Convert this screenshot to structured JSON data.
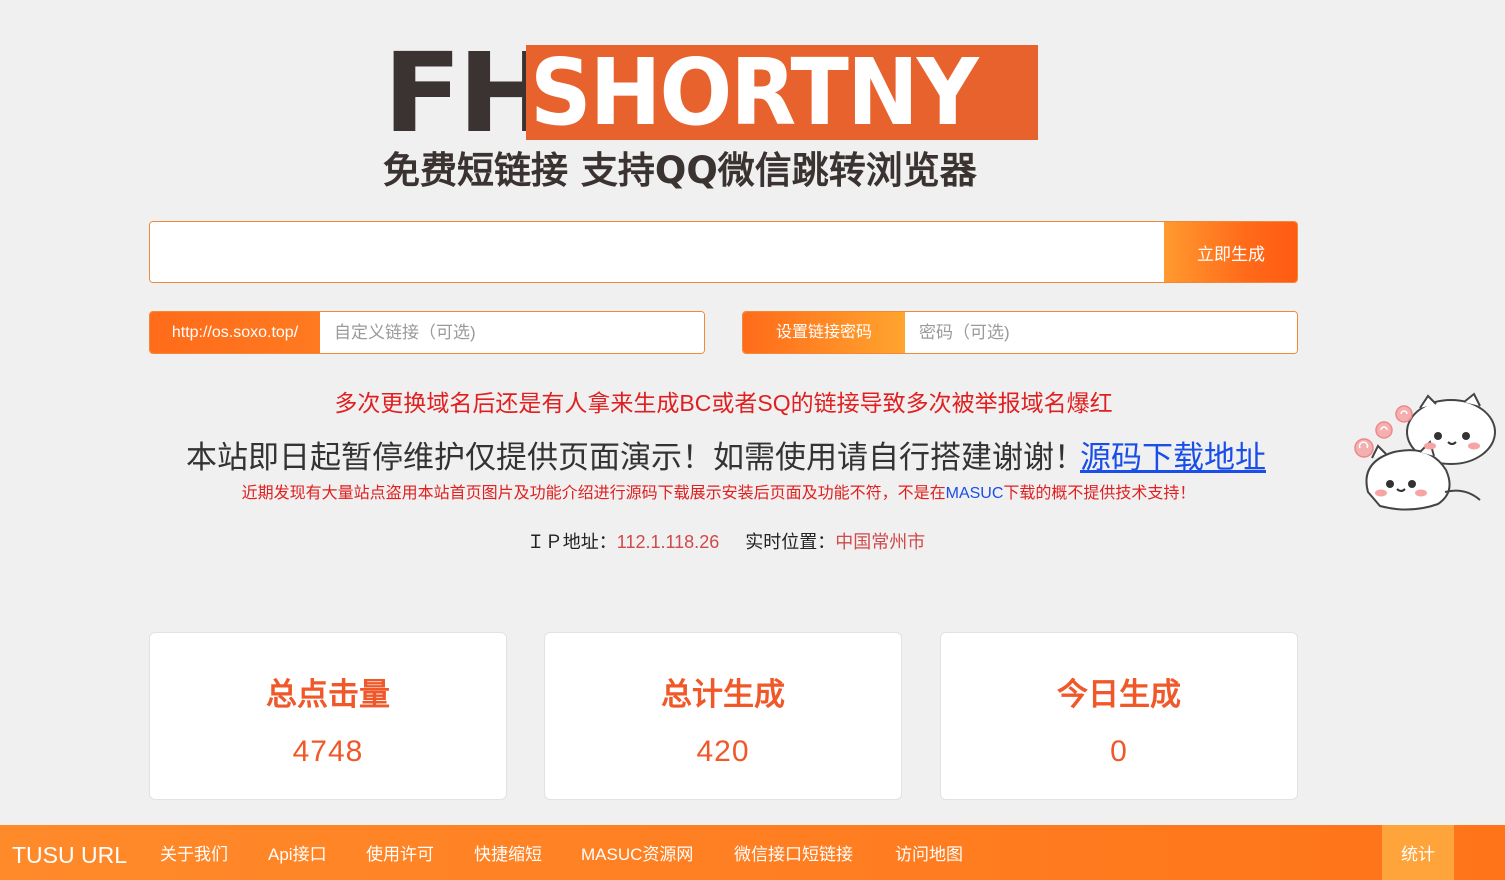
{
  "logo": {
    "mark_left": "FH",
    "mark_right": "SHORTNY",
    "slogan": "免费短链接  支持QQ微信跳转浏览器"
  },
  "generator": {
    "url_value": "",
    "button_label": "立即生成"
  },
  "custom_link": {
    "prefix": "http://os.soxo.top/",
    "placeholder": "自定义链接（可选)"
  },
  "password": {
    "label": "设置链接密码",
    "placeholder": "密码（可选)"
  },
  "notices": {
    "warning": "多次更换域名后还是有人拿来生成BC或者SQ的链接导致多次被举报域名爆红",
    "main": "本站即日起暂停维护仅提供页面演示！如需使用请自行搭建谢谢！",
    "source_link": "源码下载地址",
    "small_before": "近期发现有大量站点盗用本站首页图片及功能介绍进行源码下载展示安装后页面及功能不符，不是在",
    "small_brand": "MASUC",
    "small_after": "下载的概不提供技术支持！"
  },
  "visitor": {
    "ip_label": "ＩＰ地址：",
    "ip_value": "112.1.118.26",
    "location_label": "实时位置：",
    "location_value": "中国常州市"
  },
  "stats": [
    {
      "title": "总点击量",
      "value": "4748"
    },
    {
      "title": "总计生成",
      "value": "420"
    },
    {
      "title": "今日生成",
      "value": "0"
    }
  ],
  "nav": {
    "brand": "TUSU URL",
    "items": [
      "关于我们",
      "Api接口",
      "使用许可",
      "快捷缩短",
      "MASUC资源网",
      "微信接口短链接",
      "访问地图"
    ],
    "stats_label": "统计"
  },
  "colors": {
    "accent": "#ff7418",
    "logo_box": "#e8622e",
    "stat_text": "#f0582a",
    "warning_red": "#e02020",
    "link_blue": "#1a4ee8"
  },
  "icons": {
    "mascot": "cat-mascot"
  }
}
